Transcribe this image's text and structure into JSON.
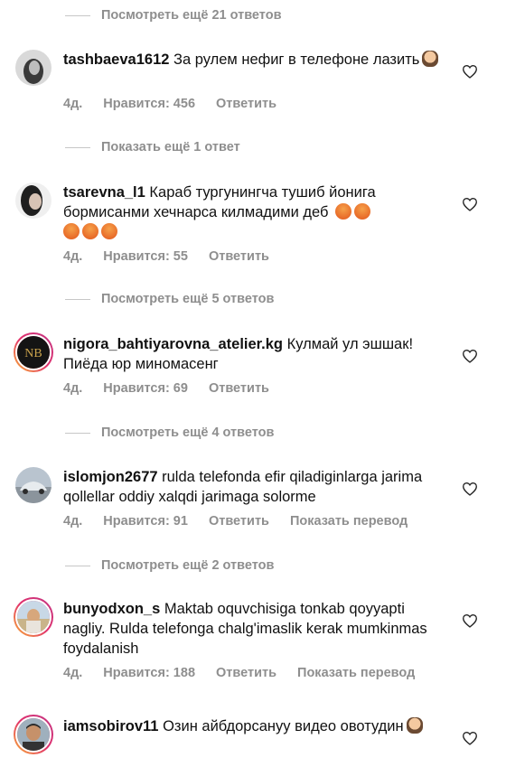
{
  "reply_toggles": [
    "Посмотреть ещё 21 ответов",
    "Показать ещё 1 ответ",
    "Посмотреть ещё 5 ответов",
    "Посмотреть ещё 4 ответов",
    "Посмотреть ещё 2 ответов"
  ],
  "comments": [
    {
      "username": "tashbaeva1612",
      "text": "За рулем нефиг в телефоне лазить",
      "age": "4д.",
      "likes": "Нравится: 456",
      "reply": "Ответить",
      "translate": ""
    },
    {
      "username": "tsarevna_l1",
      "text": "Караб тургунингча тушиб йонига бормисанми хечнарса килмадими деб",
      "age": "4д.",
      "likes": "Нравится: 55",
      "reply": "Ответить",
      "translate": ""
    },
    {
      "username": "nigora_bahtiyarovna_atelier.kg",
      "text": "Кулмай ул эшшак! Пиёда юр миномасенг",
      "age": "4д.",
      "likes": "Нравится: 69",
      "reply": "Ответить",
      "translate": ""
    },
    {
      "username": "islomjon2677",
      "text": "rulda telefonda efir  qiladiginlarga jarima qollellar oddiy xalqdi jarimaga solorme",
      "age": "4д.",
      "likes": "Нравится: 91",
      "reply": "Ответить",
      "translate": "Показать перевод"
    },
    {
      "username": "bunyodxon_s",
      "text": "Maktab oquvchisiga tonkab qoyyapti nagliy. Rulda telefonga chalg'imaslik kerak mumkinmas foydalanish",
      "age": "4д.",
      "likes": "Нравится: 188",
      "reply": "Ответить",
      "translate": "Показать перевод"
    },
    {
      "username": "iamsobirov11",
      "text": "Озин айбдорсануу видео овотудин",
      "age": "",
      "likes": "",
      "reply": "",
      "translate": ""
    }
  ],
  "colors": {
    "muted": "#8e8e8e",
    "text": "#111111",
    "divider": "#c7c7c7"
  },
  "icons": {
    "like": "heart-outline-icon"
  }
}
